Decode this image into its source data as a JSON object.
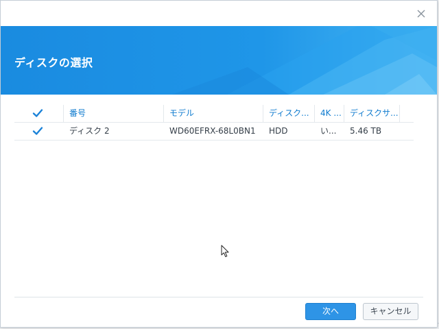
{
  "dialog": {
    "title": "ディスクの選択",
    "close_icon": "close-icon",
    "accent_color": "#1c8fe0"
  },
  "table": {
    "headers": {
      "number": "番号",
      "model": "モデル",
      "disk_type": "ディスク...",
      "fourk": "4K ...",
      "size": "ディスクサ..."
    },
    "rows": [
      {
        "checked": true,
        "number": "ディスク 2",
        "model": "WD60EFRX-68L0BN1",
        "disk_type": "HDD",
        "fourk": "い...",
        "size": "5.46 TB"
      }
    ]
  },
  "footer": {
    "next_label": "次へ",
    "cancel_label": "キャンセル"
  }
}
